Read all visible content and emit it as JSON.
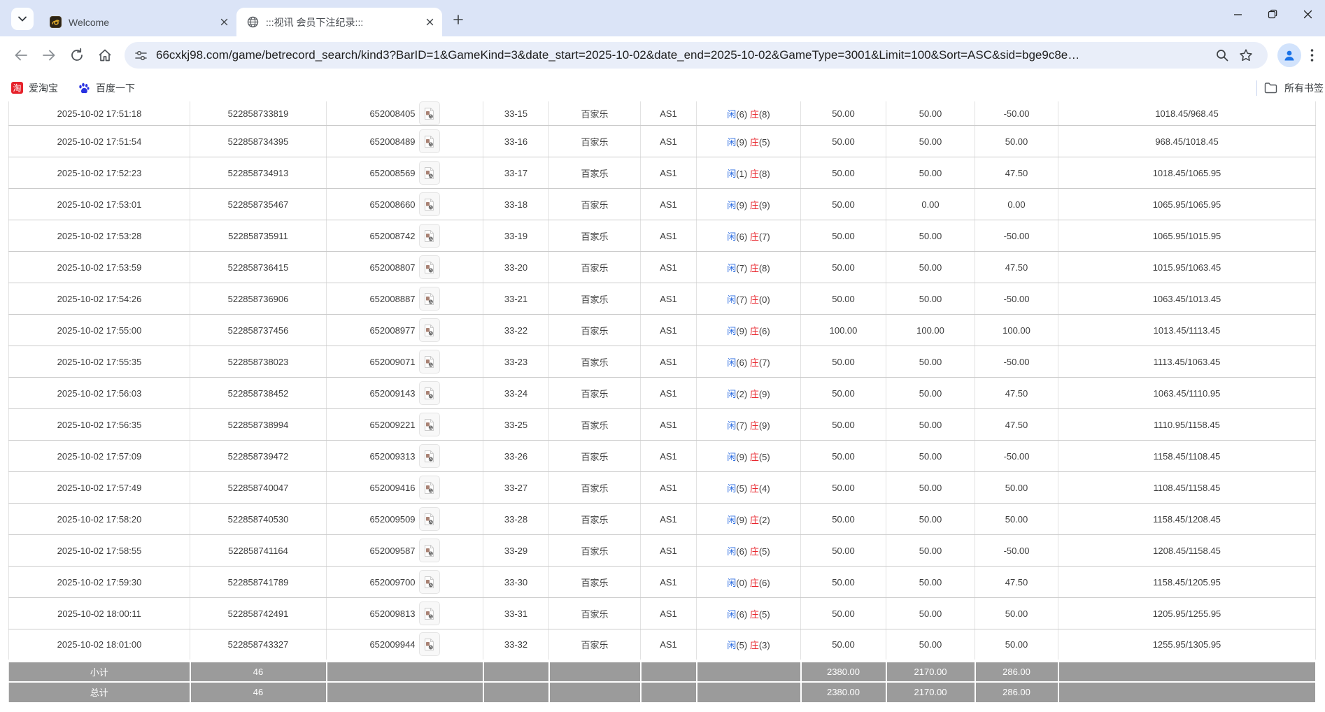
{
  "browser": {
    "tabs": [
      {
        "title": "Welcome"
      },
      {
        "title": ":::视讯 会员下注纪录:::"
      }
    ],
    "url": "66cxkj98.com/game/betrecord_search/kind3?BarID=1&GameKind=3&date_start=2025-10-02&date_end=2025-10-02&GameType=3001&Limit=100&Sort=ASC&sid=bge9c8e…",
    "bookmarks": [
      {
        "label": "爱淘宝",
        "icon_char": "淘"
      },
      {
        "label": "百度一下"
      }
    ],
    "all_bookmarks_label": "所有书签"
  },
  "colors": {
    "accent_blue": "#2a6be0",
    "loss_red": "#ee2222",
    "footer_gray": "#9b9b9b"
  },
  "table": {
    "result_labels": {
      "player": "闲",
      "banker": "庄"
    },
    "rows": [
      {
        "time": "2025-10-02 17:51:18",
        "bet_id": "522858733819",
        "round": "652008405",
        "table_no": "33-15",
        "game": "百家乐",
        "account": "AS1",
        "player_pts": "(6)",
        "banker_pts": "(8)",
        "bet": "50.00",
        "valid": "50.00",
        "win": "-50.00",
        "balance": "1018.45/968.45"
      },
      {
        "time": "2025-10-02 17:51:54",
        "bet_id": "522858734395",
        "round": "652008489",
        "table_no": "33-16",
        "game": "百家乐",
        "account": "AS1",
        "player_pts": "(9)",
        "banker_pts": "(5)",
        "bet": "50.00",
        "valid": "50.00",
        "win": "50.00",
        "balance": "968.45/1018.45"
      },
      {
        "time": "2025-10-02 17:52:23",
        "bet_id": "522858734913",
        "round": "652008569",
        "table_no": "33-17",
        "game": "百家乐",
        "account": "AS1",
        "player_pts": "(1)",
        "banker_pts": "(8)",
        "bet": "50.00",
        "valid": "50.00",
        "win": "47.50",
        "balance": "1018.45/1065.95"
      },
      {
        "time": "2025-10-02 17:53:01",
        "bet_id": "522858735467",
        "round": "652008660",
        "table_no": "33-18",
        "game": "百家乐",
        "account": "AS1",
        "player_pts": "(9)",
        "banker_pts": "(9)",
        "bet": "50.00",
        "valid": "0.00",
        "win": "0.00",
        "balance": "1065.95/1065.95"
      },
      {
        "time": "2025-10-02 17:53:28",
        "bet_id": "522858735911",
        "round": "652008742",
        "table_no": "33-19",
        "game": "百家乐",
        "account": "AS1",
        "player_pts": "(6)",
        "banker_pts": "(7)",
        "bet": "50.00",
        "valid": "50.00",
        "win": "-50.00",
        "balance": "1065.95/1015.95"
      },
      {
        "time": "2025-10-02 17:53:59",
        "bet_id": "522858736415",
        "round": "652008807",
        "table_no": "33-20",
        "game": "百家乐",
        "account": "AS1",
        "player_pts": "(7)",
        "banker_pts": "(8)",
        "bet": "50.00",
        "valid": "50.00",
        "win": "47.50",
        "balance": "1015.95/1063.45"
      },
      {
        "time": "2025-10-02 17:54:26",
        "bet_id": "522858736906",
        "round": "652008887",
        "table_no": "33-21",
        "game": "百家乐",
        "account": "AS1",
        "player_pts": "(7)",
        "banker_pts": "(0)",
        "bet": "50.00",
        "valid": "50.00",
        "win": "-50.00",
        "balance": "1063.45/1013.45"
      },
      {
        "time": "2025-10-02 17:55:00",
        "bet_id": "522858737456",
        "round": "652008977",
        "table_no": "33-22",
        "game": "百家乐",
        "account": "AS1",
        "player_pts": "(9)",
        "banker_pts": "(6)",
        "bet": "100.00",
        "valid": "100.00",
        "win": "100.00",
        "balance": "1013.45/1113.45"
      },
      {
        "time": "2025-10-02 17:55:35",
        "bet_id": "522858738023",
        "round": "652009071",
        "table_no": "33-23",
        "game": "百家乐",
        "account": "AS1",
        "player_pts": "(6)",
        "banker_pts": "(7)",
        "bet": "50.00",
        "valid": "50.00",
        "win": "-50.00",
        "balance": "1113.45/1063.45"
      },
      {
        "time": "2025-10-02 17:56:03",
        "bet_id": "522858738452",
        "round": "652009143",
        "table_no": "33-24",
        "game": "百家乐",
        "account": "AS1",
        "player_pts": "(2)",
        "banker_pts": "(9)",
        "bet": "50.00",
        "valid": "50.00",
        "win": "47.50",
        "balance": "1063.45/1110.95"
      },
      {
        "time": "2025-10-02 17:56:35",
        "bet_id": "522858738994",
        "round": "652009221",
        "table_no": "33-25",
        "game": "百家乐",
        "account": "AS1",
        "player_pts": "(7)",
        "banker_pts": "(9)",
        "bet": "50.00",
        "valid": "50.00",
        "win": "47.50",
        "balance": "1110.95/1158.45"
      },
      {
        "time": "2025-10-02 17:57:09",
        "bet_id": "522858739472",
        "round": "652009313",
        "table_no": "33-26",
        "game": "百家乐",
        "account": "AS1",
        "player_pts": "(9)",
        "banker_pts": "(5)",
        "bet": "50.00",
        "valid": "50.00",
        "win": "-50.00",
        "balance": "1158.45/1108.45"
      },
      {
        "time": "2025-10-02 17:57:49",
        "bet_id": "522858740047",
        "round": "652009416",
        "table_no": "33-27",
        "game": "百家乐",
        "account": "AS1",
        "player_pts": "(5)",
        "banker_pts": "(4)",
        "bet": "50.00",
        "valid": "50.00",
        "win": "50.00",
        "balance": "1108.45/1158.45"
      },
      {
        "time": "2025-10-02 17:58:20",
        "bet_id": "522858740530",
        "round": "652009509",
        "table_no": "33-28",
        "game": "百家乐",
        "account": "AS1",
        "player_pts": "(9)",
        "banker_pts": "(2)",
        "bet": "50.00",
        "valid": "50.00",
        "win": "50.00",
        "balance": "1158.45/1208.45"
      },
      {
        "time": "2025-10-02 17:58:55",
        "bet_id": "522858741164",
        "round": "652009587",
        "table_no": "33-29",
        "game": "百家乐",
        "account": "AS1",
        "player_pts": "(6)",
        "banker_pts": "(5)",
        "bet": "50.00",
        "valid": "50.00",
        "win": "-50.00",
        "balance": "1208.45/1158.45"
      },
      {
        "time": "2025-10-02 17:59:30",
        "bet_id": "522858741789",
        "round": "652009700",
        "table_no": "33-30",
        "game": "百家乐",
        "account": "AS1",
        "player_pts": "(0)",
        "banker_pts": "(6)",
        "bet": "50.00",
        "valid": "50.00",
        "win": "47.50",
        "balance": "1158.45/1205.95"
      },
      {
        "time": "2025-10-02 18:00:11",
        "bet_id": "522858742491",
        "round": "652009813",
        "table_no": "33-31",
        "game": "百家乐",
        "account": "AS1",
        "player_pts": "(6)",
        "banker_pts": "(5)",
        "bet": "50.00",
        "valid": "50.00",
        "win": "50.00",
        "balance": "1205.95/1255.95"
      },
      {
        "time": "2025-10-02 18:01:00",
        "bet_id": "522858743327",
        "round": "652009944",
        "table_no": "33-32",
        "game": "百家乐",
        "account": "AS1",
        "player_pts": "(5)",
        "banker_pts": "(3)",
        "bet": "50.00",
        "valid": "50.00",
        "win": "50.00",
        "balance": "1255.95/1305.95"
      }
    ],
    "footer": [
      {
        "label": "小计",
        "count": "46",
        "bet": "2380.00",
        "valid": "2170.00",
        "win": "286.00"
      },
      {
        "label": "总计",
        "count": "46",
        "bet": "2380.00",
        "valid": "2170.00",
        "win": "286.00"
      }
    ]
  }
}
